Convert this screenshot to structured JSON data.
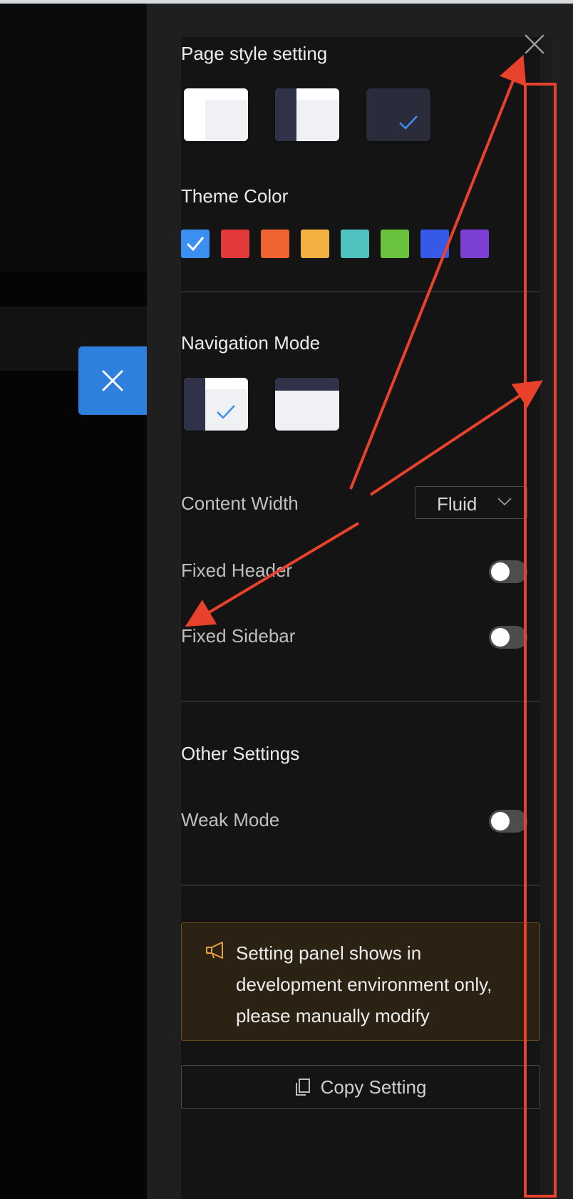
{
  "panel": {
    "page_style_title": "Page style setting",
    "theme_color_title": "Theme Color",
    "navigation_mode_title": "Navigation Mode",
    "other_settings_title": "Other Settings"
  },
  "theme_colors": [
    "#3a8ff0",
    "#e2393a",
    "#ee6331",
    "#f2b141",
    "#4fc3bf",
    "#6ac23d",
    "#3659e8",
    "#7c3fd3"
  ],
  "selected_theme_color": "#3a8ff0",
  "selected_page_style": "dark",
  "selected_navigation_mode": "side-menu",
  "settings": {
    "content_width": {
      "label": "Content Width",
      "value": "Fluid"
    },
    "fixed_header": {
      "label": "Fixed Header",
      "enabled": false
    },
    "fixed_sidebar": {
      "label": "Fixed Sidebar",
      "enabled": false
    },
    "weak_mode": {
      "label": "Weak Mode",
      "enabled": false
    }
  },
  "notice": {
    "text": "Setting panel shows in development environment only, please manually modify"
  },
  "copy_button": {
    "label": "Copy Setting"
  },
  "colors": {
    "accent": "#3a8ff0",
    "annotation_red": "#e8412c",
    "notice_icon": "#e5a13b"
  },
  "icons": {
    "close": "close-icon",
    "drawer_toggle": "close-icon",
    "notice": "megaphone-icon",
    "copy": "copy-icon",
    "select": "chevron-down-icon",
    "check": "check-icon"
  }
}
